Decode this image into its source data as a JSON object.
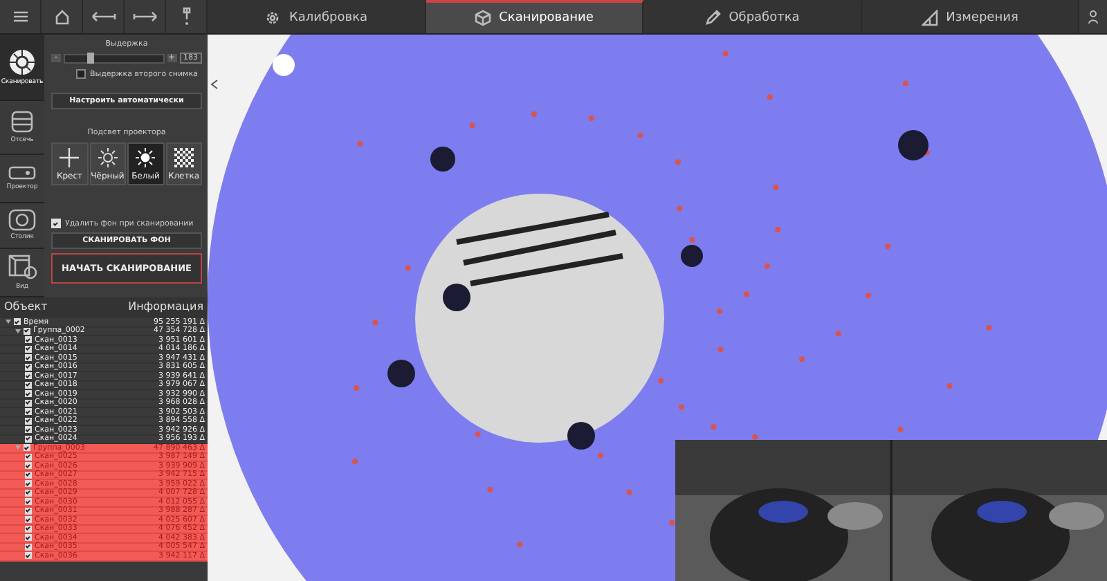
{
  "toolbar": {
    "buttons": [
      {
        "kind": "menu"
      },
      {
        "kind": "home"
      },
      {
        "kind": "back"
      },
      {
        "kind": "forward"
      },
      {
        "kind": "probe"
      }
    ]
  },
  "tabs": [
    {
      "label": "Калибровка",
      "kind": "gear",
      "selected": false
    },
    {
      "label": "Сканирование",
      "kind": "cube",
      "selected": true
    },
    {
      "label": "Обработка",
      "kind": "pencil",
      "selected": false
    },
    {
      "label": "Измерения",
      "kind": "triangle",
      "selected": false
    }
  ],
  "side_tools": [
    {
      "label": "Сканировать",
      "kind": "aperture",
      "selected": true
    },
    {
      "label": "Отсечь",
      "kind": "cut",
      "selected": false
    },
    {
      "label": "Проектор",
      "kind": "projector",
      "selected": false
    },
    {
      "label": "Столик",
      "kind": "table",
      "selected": false
    },
    {
      "label": "Вид",
      "kind": "view",
      "selected": false
    }
  ],
  "scan_settings": {
    "exposure": {
      "title": "Выдержка",
      "minus": "-",
      "plus": "+",
      "level": 0.25,
      "value": "183"
    },
    "second_exposure": {
      "label": "Выдержка второго снимка",
      "checked": false
    },
    "auto_button": "Настроить автоматически",
    "projector_title": "Подсвет проектора",
    "patterns": [
      {
        "label": "Крест",
        "kind": "cross",
        "selected": false
      },
      {
        "label": "Чёрный",
        "kind": "sun-outline",
        "selected": false
      },
      {
        "label": "Белый",
        "kind": "sun-filled",
        "selected": true
      },
      {
        "label": "Клетка",
        "kind": "checker",
        "selected": false
      }
    ],
    "remove_background": {
      "label": "Удалить фон при сканировании",
      "checked": true
    },
    "scan_background_button": "СКАНИРОВАТЬ ФОН",
    "start_button": "НАЧАТЬ СКАНИРОВАНИЕ"
  },
  "object_tree": {
    "columns": [
      "Объект",
      "Информация"
    ],
    "items": [
      {
        "name": "Время",
        "info": "95 255 191 Δ",
        "checked": true,
        "selected": false,
        "expanded": true,
        "children": [
          {
            "name": "Группа_0002",
            "info": "47 354 728 Δ",
            "checked": true,
            "selected": false,
            "expanded": true,
            "children": [
              {
                "name": "Скан_0013",
                "info": "3 951 601 Δ",
                "checked": true,
                "selected": false
              },
              {
                "name": "Скан_0014",
                "info": "4 014 186 Δ",
                "checked": true,
                "selected": false
              },
              {
                "name": "Скан_0015",
                "info": "3 947 431 Δ",
                "checked": true,
                "selected": false
              },
              {
                "name": "Скан_0016",
                "info": "3 831 605 Δ",
                "checked": true,
                "selected": false
              },
              {
                "name": "Скан_0017",
                "info": "3 939 641 Δ",
                "checked": true,
                "selected": false
              },
              {
                "name": "Скан_0018",
                "info": "3 979 067 Δ",
                "checked": true,
                "selected": false
              },
              {
                "name": "Скан_0019",
                "info": "3 932 990 Δ",
                "checked": true,
                "selected": false
              },
              {
                "name": "Скан_0020",
                "info": "3 968 028 Δ",
                "checked": true,
                "selected": false
              },
              {
                "name": "Скан_0021",
                "info": "3 902 503 Δ",
                "checked": true,
                "selected": false
              },
              {
                "name": "Скан_0022",
                "info": "3 894 558 Δ",
                "checked": true,
                "selected": false
              },
              {
                "name": "Скан_0023",
                "info": "3 942 926 Δ",
                "checked": true,
                "selected": false
              },
              {
                "name": "Скан_0024",
                "info": "3 956 193 Δ",
                "checked": true,
                "selected": false
              }
            ]
          },
          {
            "name": "Группа_0003",
            "info": "47 890 463 Δ",
            "checked": true,
            "selected": true,
            "expanded": true,
            "children": [
              {
                "name": "Скан_0025",
                "info": "3 987 149 Δ",
                "checked": true,
                "selected": true
              },
              {
                "name": "Скан_0026",
                "info": "3 939 909 Δ",
                "checked": true,
                "selected": true
              },
              {
                "name": "Скан_0027",
                "info": "3 942 715 Δ",
                "checked": true,
                "selected": true
              },
              {
                "name": "Скан_0028",
                "info": "3 959 022 Δ",
                "checked": true,
                "selected": true
              },
              {
                "name": "Скан_0029",
                "info": "4 007 728 Δ",
                "checked": true,
                "selected": true
              },
              {
                "name": "Скан_0030",
                "info": "4 012 055 Δ",
                "checked": true,
                "selected": true
              },
              {
                "name": "Скан_0031",
                "info": "3 988 287 Δ",
                "checked": true,
                "selected": true
              },
              {
                "name": "Скан_0032",
                "info": "4 025 607 Δ",
                "checked": true,
                "selected": true
              },
              {
                "name": "Скан_0033",
                "info": "4 076 452 Δ",
                "checked": true,
                "selected": true
              },
              {
                "name": "Скан_0034",
                "info": "4 042 383 Δ",
                "checked": true,
                "selected": true
              },
              {
                "name": "Скан_0035",
                "info": "4 005 547 Δ",
                "checked": true,
                "selected": true
              },
              {
                "name": "Скан_0036",
                "info": "3 942 117 Δ",
                "checked": true,
                "selected": true
              }
            ]
          }
        ]
      }
    ]
  }
}
